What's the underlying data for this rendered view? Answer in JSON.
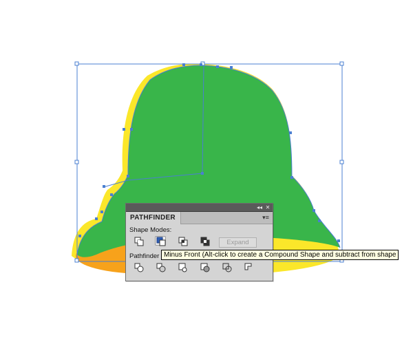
{
  "artwork": {
    "bell_body_color": "#39b54a",
    "bell_offset_color": "#fbe72a",
    "bell_rim_color": "#f7a21b",
    "selection_color": "#4a7fd1"
  },
  "panel": {
    "title": "PATHFINDER",
    "menu_icon": "panel-menu-icon",
    "shape_modes_label": "Shape Modes:",
    "pathfinders_label": "Pathfinder",
    "expand_label": "Expand",
    "shape_mode_icons": [
      "unite-icon",
      "minus-front-icon",
      "intersect-icon",
      "exclude-icon"
    ],
    "pathfinder_icons": [
      "divide-icon",
      "trim-icon",
      "merge-icon",
      "crop-icon",
      "outline-icon",
      "minus-back-icon"
    ]
  },
  "tooltip": {
    "text": "Minus Front (Alt-click to create a Compound Shape and subtract from shape"
  }
}
